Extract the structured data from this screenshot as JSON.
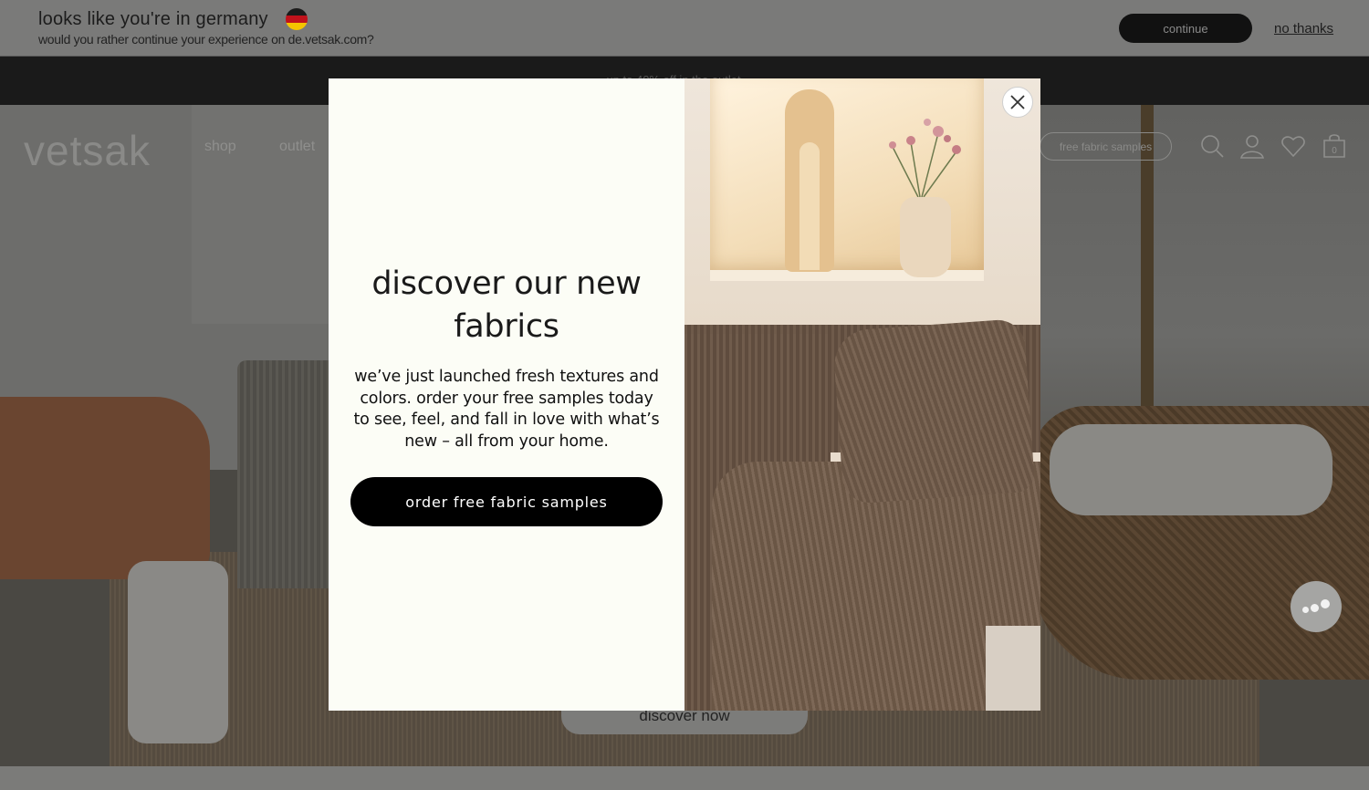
{
  "geo_banner": {
    "title": "looks like you're in germany",
    "subtitle": "would you rather continue your experience on de.vetsak.com?",
    "continue_label": "continue",
    "no_thanks_label": "no thanks",
    "flag_icon": "germany-flag-icon"
  },
  "promo_bar": {
    "text": "... up to 40% off in the outlet ..."
  },
  "header": {
    "logo": "vetsak",
    "nav": [
      {
        "label": "shop"
      },
      {
        "label": "outlet"
      }
    ],
    "fabric_samples_label": "free fabric samples",
    "icons": [
      "search-icon",
      "account-icon",
      "wishlist-heart-icon",
      "cart-icon"
    ],
    "cart_count": "0"
  },
  "hero": {
    "discover_label": "discover now"
  },
  "modal": {
    "heading": "discover our new fabrics",
    "body": "we’ve just launched fresh textures and colors. order your free samples today to see, feel, and fall in love with what’s new – all from your home.",
    "cta_label": "order free fabric samples",
    "close_icon": "close-icon"
  },
  "chat": {
    "icon": "chat-bubble-icon"
  },
  "colors": {
    "overlay": "#6f6f6f",
    "modal_bg": "#fcfdf6",
    "cta_bg": "#000000",
    "promo_bg": "#1a1a1a"
  }
}
